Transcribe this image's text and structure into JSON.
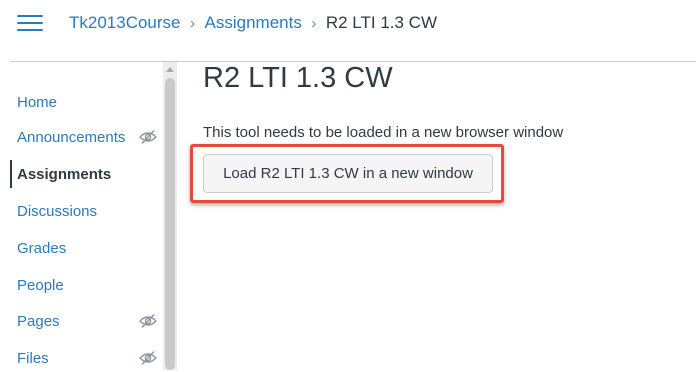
{
  "header": {
    "menu_icon": "hamburger-icon",
    "breadcrumb": {
      "course": "Tk2013Course",
      "section": "Assignments",
      "current": "R2 LTI 1.3 CW",
      "separator": "›"
    }
  },
  "sidebar": {
    "items": [
      {
        "label": "Home",
        "active": false,
        "hidden_icon": false
      },
      {
        "label": "Announcements",
        "active": false,
        "hidden_icon": true
      },
      {
        "label": "Assignments",
        "active": true,
        "hidden_icon": false
      },
      {
        "label": "Discussions",
        "active": false,
        "hidden_icon": false
      },
      {
        "label": "Grades",
        "active": false,
        "hidden_icon": false
      },
      {
        "label": "People",
        "active": false,
        "hidden_icon": false
      },
      {
        "label": "Pages",
        "active": false,
        "hidden_icon": true
      },
      {
        "label": "Files",
        "active": false,
        "hidden_icon": true
      }
    ]
  },
  "main": {
    "title": "R2 LTI 1.3 CW",
    "message": "This tool needs to be loaded in a new browser window",
    "button_label": "Load R2 LTI 1.3 CW in a new window"
  },
  "colors": {
    "link": "#2b7abc",
    "text": "#2d3b45",
    "highlight": "#e7493a"
  }
}
